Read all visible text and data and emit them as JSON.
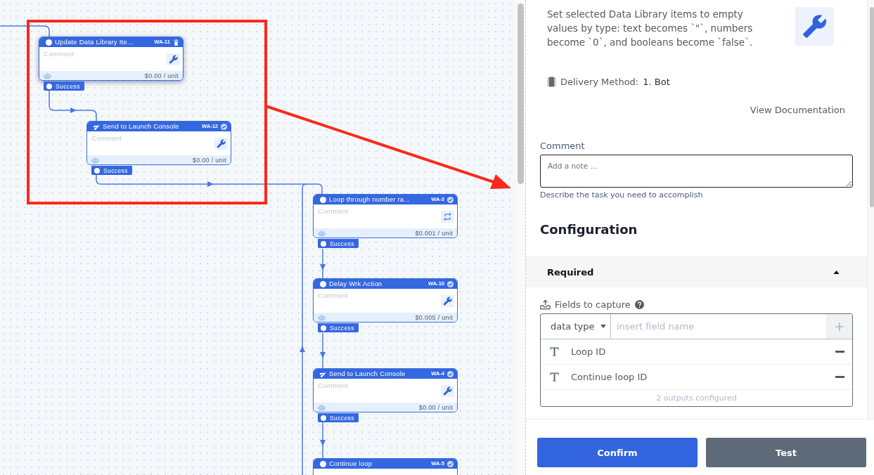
{
  "canvas": {
    "nodes": [
      {
        "kind": "update",
        "title": "Update Data Library Ite...",
        "code": "WA-11",
        "selected": true,
        "comment_placeholder": "Comment",
        "price": "$0.00 / unit",
        "outcome": "Success"
      },
      {
        "kind": "send",
        "title": "Send to Launch Console",
        "code": "WA-12",
        "selected": false,
        "comment_placeholder": "Comment",
        "price": "$0.00 / unit",
        "outcome": "Success"
      },
      {
        "kind": "loop",
        "title": "Loop through number ra...",
        "code": "WA-3",
        "selected": false,
        "comment_placeholder": "Comment",
        "price": "$0.001 / unit",
        "outcome": "Success"
      },
      {
        "kind": "action",
        "title": "Delay Wrk Action",
        "code": "WA-10",
        "selected": false,
        "comment_placeholder": "Comment",
        "price": "$0.005 / unit",
        "outcome": "Success"
      },
      {
        "kind": "send",
        "title": "Send to Launch Console",
        "code": "WA-4",
        "selected": false,
        "comment_placeholder": "Comment",
        "price": "$0.00 / unit",
        "outcome": "Success"
      },
      {
        "kind": "action",
        "title": "Continue loop",
        "code": "WA-5",
        "selected": false
      }
    ]
  },
  "panel": {
    "description": "Set selected Data Library items to empty values by type: text becomes `\"`, numbers become `0`, and booleans become `false`.",
    "delivery": {
      "label": "Delivery Method:",
      "value": "1. Bot"
    },
    "doc_link": "View Documentation",
    "comment": {
      "label": "Comment",
      "placeholder": "Add a note ...",
      "hint": "Describe the task you need to accomplish"
    },
    "section_title": "Configuration",
    "required": {
      "title": "Required",
      "expanded": true,
      "fields_label": "Fields to capture",
      "type_select": "data type",
      "field_placeholder": "insert field name",
      "fields": [
        {
          "name": "Loop ID"
        },
        {
          "name": "Continue loop ID"
        }
      ],
      "summary": "2 outputs configured"
    }
  },
  "actions": [
    {
      "label": "Confirm",
      "kind": "primary"
    },
    {
      "label": "Test",
      "kind": "secondary"
    }
  ]
}
